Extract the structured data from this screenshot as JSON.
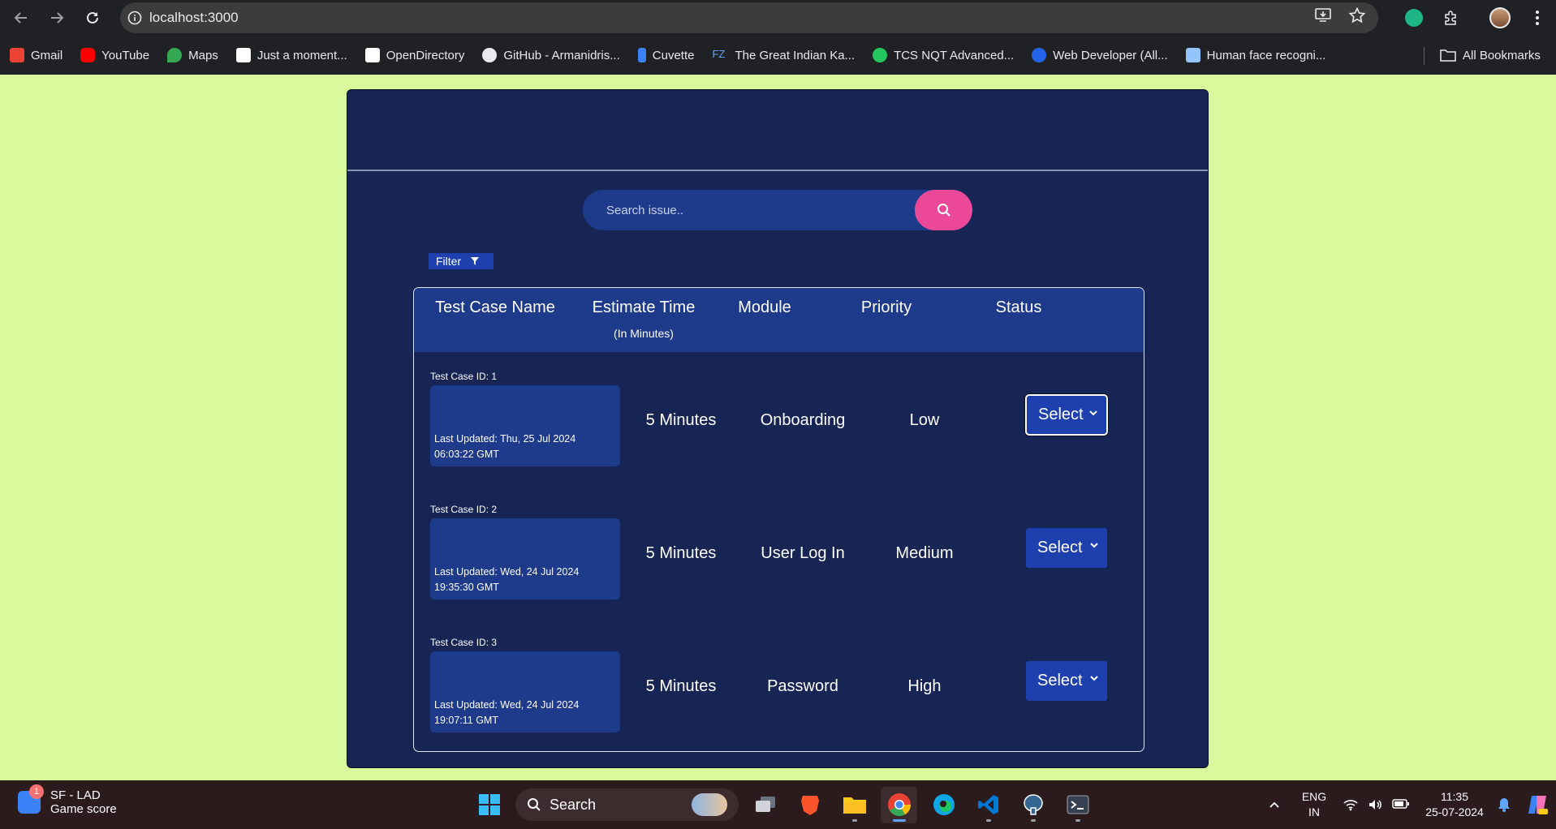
{
  "browser": {
    "url": "localhost:3000",
    "bookmarks": [
      {
        "label": "Gmail",
        "color": "#ea4335"
      },
      {
        "label": "YouTube",
        "color": "#ff0000"
      },
      {
        "label": "Maps",
        "color": "#34a853"
      },
      {
        "label": "Just a moment...",
        "color": "#ffffff"
      },
      {
        "label": "OpenDirectory",
        "color": "#ffffff"
      },
      {
        "label": "GitHub - Armanidris...",
        "color": "#e8eaed"
      },
      {
        "label": "Cuvette",
        "color": "#3b82f6"
      },
      {
        "label": "The Great Indian Ka...",
        "color": "#60a5fa"
      },
      {
        "label": "TCS NQT Advanced...",
        "color": "#22c55e"
      },
      {
        "label": "Web Developer (All...",
        "color": "#2563eb"
      },
      {
        "label": "Human face recogni...",
        "color": "#93c5fd"
      }
    ],
    "all_bookmarks": "All Bookmarks"
  },
  "search": {
    "placeholder": "Search issue.."
  },
  "filter": {
    "label": "Filter"
  },
  "table": {
    "headers": {
      "name": "Test Case Name",
      "estimate": "Estimate Time",
      "estimate_sub": "(In Minutes)",
      "module": "Module",
      "priority": "Priority",
      "status": "Status"
    },
    "rows": [
      {
        "id_label": "Test Case ID: 1",
        "updated": "Last Updated: Thu, 25 Jul 2024 06:03:22 GMT",
        "estimate": "5 Minutes",
        "module": "Onboarding",
        "priority": "Low",
        "status": "Select"
      },
      {
        "id_label": "Test Case ID: 2",
        "updated": "Last Updated: Wed, 24 Jul 2024 19:35:30 GMT",
        "estimate": "5 Minutes",
        "module": "User Log In",
        "priority": "Medium",
        "status": "Select"
      },
      {
        "id_label": "Test Case ID: 3",
        "updated": "Last Updated: Wed, 24 Jul 2024 19:07:11 GMT",
        "estimate": "5 Minutes",
        "module": "Password",
        "priority": "High",
        "status": "Select"
      }
    ]
  },
  "taskbar": {
    "widget_badge": "1",
    "widget_title": "SF - LAD",
    "widget_sub": "Game score",
    "search_label": "Search",
    "lang_top": "ENG",
    "lang_bottom": "IN",
    "time": "11:35",
    "date": "25-07-2024"
  },
  "colors": {
    "page_bg": "#d9f99d",
    "card_bg": "#172554",
    "panel_bg": "#1e3a8a",
    "accent": "#ec4899"
  }
}
